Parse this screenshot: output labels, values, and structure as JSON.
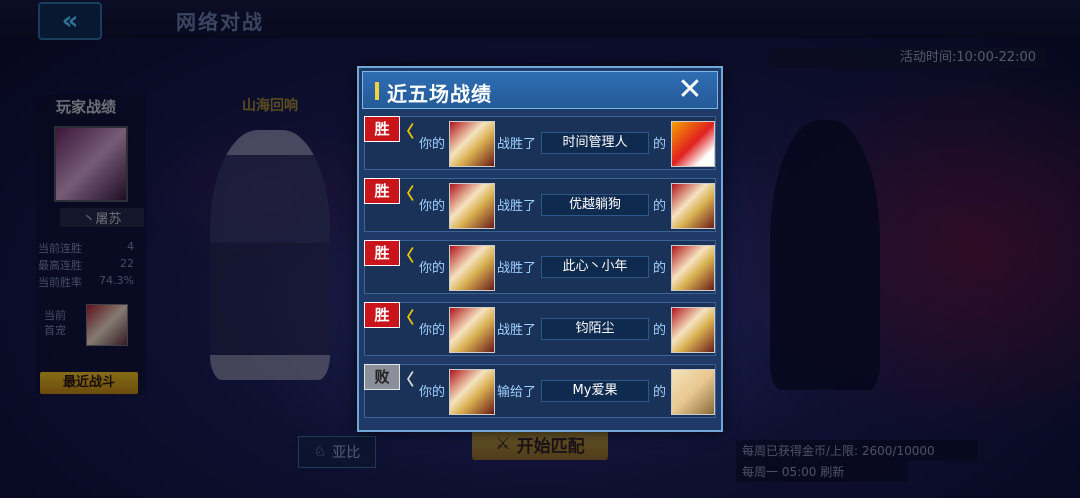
{
  "header": {
    "back_glyph": "«",
    "title": "网络对战",
    "event_time": "活动时间:10:00-22:00"
  },
  "left_panel": {
    "title": "玩家战绩",
    "player_name": "丶屠苏",
    "stats": [
      {
        "label": "当前连胜",
        "value": "4"
      },
      {
        "label": "最高连胜",
        "value": "22"
      },
      {
        "label": "当前胜率",
        "value": "74.3%"
      }
    ],
    "pet_label": "当前首宠",
    "recent_battles_button": "最近战斗"
  },
  "banner_left": "山海回响",
  "bottom": {
    "yabi_button": "亚比",
    "start_match_button": "开始匹配",
    "gold_info": "每周已获得金币/上限: 2600/10000",
    "refresh_info": "每周一 05:00 刷新"
  },
  "modal": {
    "title": "近五场战绩",
    "close_glyph": "✕",
    "rows": [
      {
        "result": "胜",
        "result_type": "win",
        "your": "你的",
        "verb": "战胜了",
        "opponent": "时间管理人",
        "de": "的",
        "opp_avatar": "t1"
      },
      {
        "result": "胜",
        "result_type": "win",
        "your": "你的",
        "verb": "战胜了",
        "opponent": "优越躺狗",
        "de": "的",
        "opp_avatar": "t2"
      },
      {
        "result": "胜",
        "result_type": "win",
        "your": "你的",
        "verb": "战胜了",
        "opponent": "此心丶小年",
        "de": "的",
        "opp_avatar": "t2"
      },
      {
        "result": "胜",
        "result_type": "win",
        "your": "你的",
        "verb": "战胜了",
        "opponent": "钧陌尘",
        "de": "的",
        "opp_avatar": "t2"
      },
      {
        "result": "败",
        "result_type": "lose",
        "your": "你的",
        "verb": "输给了",
        "opponent": "My爱果",
        "de": "的",
        "opp_avatar": "t3"
      }
    ]
  },
  "colors": {
    "accent": "#f6d33a",
    "win": "#c8141a",
    "lose": "#8a8f99",
    "modal_bg": "#1f3a66"
  }
}
